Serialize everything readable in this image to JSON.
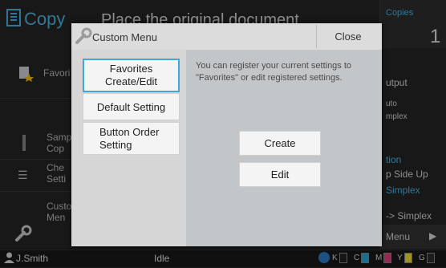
{
  "app": {
    "title": "Copy",
    "top_message": "Place the original document",
    "copies_label": "Copies",
    "copies_value": "1"
  },
  "left_panel": {
    "items": [
      {
        "label": "Favori"
      },
      {
        "label": "Samp Cop"
      },
      {
        "label": "Che Setti"
      },
      {
        "label": "Custo Men"
      }
    ]
  },
  "right_panel": {
    "texts": [
      "utput",
      "uto",
      "mplex",
      "tion",
      "p Side Up",
      "Simplex",
      "-> Simplex",
      "Menu"
    ]
  },
  "status_bar": {
    "user": "J.Smith",
    "status": "Idle",
    "inks": [
      "K",
      "C",
      "M",
      "Y",
      "G"
    ],
    "ink_colors": [
      "#222222",
      "#27a9e1",
      "#e0447f",
      "#f2e23a",
      "#2e2e2e"
    ]
  },
  "dialog": {
    "title": "Custom Menu",
    "close_label": "Close",
    "menu": [
      {
        "label": "Favorites Create/Edit",
        "selected": true
      },
      {
        "label": "Default Setting",
        "selected": false
      },
      {
        "label": "Button Order Setting",
        "selected": false
      }
    ],
    "description": "You can register your current settings to \"Favorites\" or edit registered settings.",
    "create_label": "Create",
    "edit_label": "Edit"
  }
}
